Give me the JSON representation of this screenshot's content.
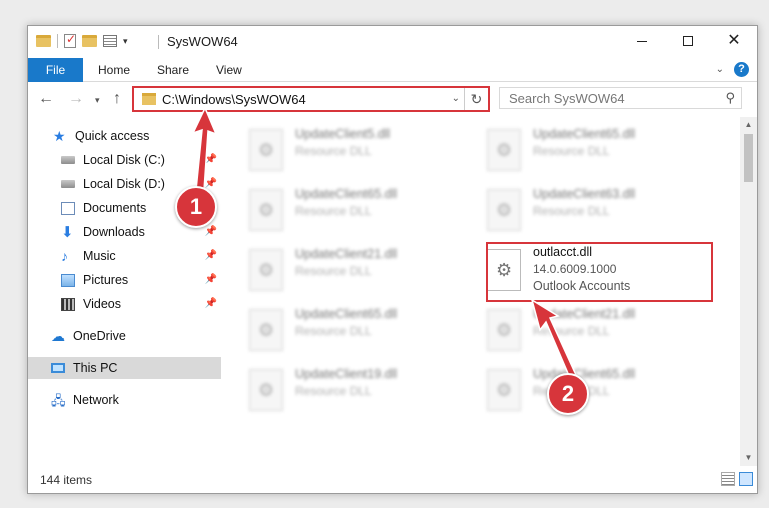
{
  "window": {
    "title": "SysWOW64"
  },
  "controls": {
    "minimize": "—",
    "maximize": "☐",
    "close": "✕"
  },
  "ribbon": {
    "tabs": [
      "File",
      "Home",
      "Share",
      "View"
    ],
    "help": "?"
  },
  "address": {
    "path": "C:\\Windows\\SysWOW64"
  },
  "search": {
    "placeholder": "Search SysWOW64"
  },
  "nav": {
    "quick_access": "Quick access",
    "items": [
      {
        "label": "Local Disk (C:)",
        "icon": "drive-icon",
        "pinned": true
      },
      {
        "label": "Local Disk (D:)",
        "icon": "drive-icon",
        "pinned": true
      },
      {
        "label": "Documents",
        "icon": "documents-icon",
        "pinned": true
      },
      {
        "label": "Downloads",
        "icon": "downloads-icon",
        "pinned": true
      },
      {
        "label": "Music",
        "icon": "music-icon",
        "pinned": true
      },
      {
        "label": "Pictures",
        "icon": "pictures-icon",
        "pinned": true
      },
      {
        "label": "Videos",
        "icon": "videos-icon",
        "pinned": true
      }
    ],
    "onedrive": "OneDrive",
    "this_pc": "This PC",
    "network": "Network"
  },
  "files": [
    {
      "name": "UpdateClient5.dll",
      "type": "Resource DLL"
    },
    {
      "name": "UpdateClient65.dll",
      "type": "Resource DLL"
    },
    {
      "name": "UpdateClient65.dll",
      "type": "Resource DLL"
    },
    {
      "name": "UpdateClient63.dll",
      "type": "Resource DLL"
    },
    {
      "name": "UpdateClient21.dll",
      "type": "Resource DLL"
    },
    {
      "name": "outlacct.dll",
      "version": "14.0.6009.1000",
      "description": "Outlook Accounts",
      "highlighted": true
    },
    {
      "name": "UpdateClient65.dll",
      "type": "Resource DLL"
    },
    {
      "name": "UpdateClient21.dll",
      "type": "Resource DLL"
    },
    {
      "name": "UpdateClient19.dll",
      "type": "Resource DLL"
    },
    {
      "name": "UpdateClient65.dll",
      "type": "Resource DLL"
    }
  ],
  "status": {
    "item_count": "144 items"
  },
  "callouts": {
    "one": "1",
    "two": "2"
  },
  "colors": {
    "accent": "#1979ca",
    "callout": "#d7353b",
    "selection": "#d9d9d9"
  }
}
